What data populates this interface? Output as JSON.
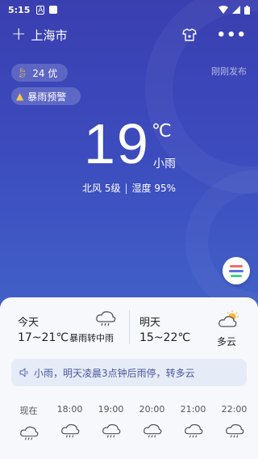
{
  "status_bar": {
    "time": "5:15",
    "a_icon": "A",
    "icons": [
      "notification-a-icon",
      "square-icon",
      "wifi-icon",
      "signal-icon",
      "battery-icon"
    ]
  },
  "header": {
    "add_icon": "+",
    "city": "上海市",
    "more_icon": "•••"
  },
  "aqi": {
    "value": "24 优",
    "icon": "leaf-icon"
  },
  "alert": {
    "label": "暴雨预警",
    "icon": "warning-icon"
  },
  "published": "刚刚发布",
  "current": {
    "temperature": "19",
    "unit": "℃",
    "condition": "小雨",
    "wind": "北风 5级",
    "separator": "|",
    "humidity": "湿度 95%"
  },
  "forecast": {
    "today": {
      "label": "今天",
      "range": "17~21℃",
      "condition": "暴雨转中雨",
      "icon": "rain-cloud-icon"
    },
    "tomorrow": {
      "label": "明天",
      "range": "15~22℃",
      "condition": "多云",
      "icon": "partly-cloudy-icon"
    }
  },
  "notice": {
    "text": "小雨，明天凌晨3点钟后雨停，转多云",
    "icon": "speaker-icon"
  },
  "hourly": [
    {
      "time": "现在",
      "icon": "rain-cloud-icon"
    },
    {
      "time": "18:00",
      "icon": "rain-cloud-icon"
    },
    {
      "time": "19:00",
      "icon": "rain-cloud-icon"
    },
    {
      "time": "20:00",
      "icon": "rain-cloud-icon"
    },
    {
      "time": "21:00",
      "icon": "rain-cloud-icon"
    },
    {
      "time": "22:00",
      "icon": "rain-cloud-icon"
    }
  ],
  "colors": {
    "accent_blue": "#3c4bbd",
    "fab_red": "#f06a6a",
    "fab_blue": "#5b6ee1",
    "fab_green": "#3fcf8e"
  }
}
